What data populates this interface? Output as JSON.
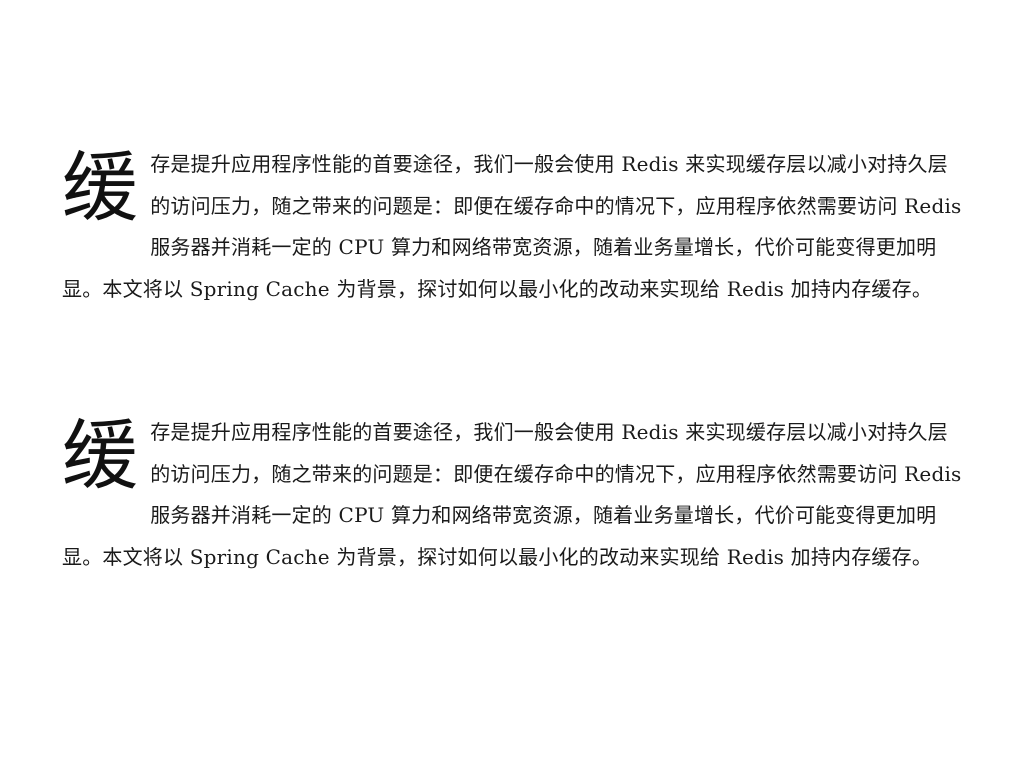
{
  "paragraphs": [
    {
      "dropcap": "缓",
      "text": "存是提升应用程序性能的首要途径，我们一般会使用 Redis 来实现缓存层以减小对持久层的访问压力，随之带来的问题是：即便在缓存命中的情况下，应用程序依然需要访问 Redis 服务器并消耗一定的 CPU 算力和网络带宽资源，随着业务量增长，代价可能变得更加明显。本文将以 Spring Cache 为背景，探讨如何以最小化的改动来实现给 Redis 加持内存缓存。"
    },
    {
      "dropcap": "缓",
      "text": "存是提升应用程序性能的首要途径，我们一般会使用 Redis 来实现缓存层以减小对持久层的访问压力，随之带来的问题是：即便在缓存命中的情况下，应用程序依然需要访问 Redis 服务器并消耗一定的 CPU 算力和网络带宽资源，随着业务量增长，代价可能变得更加明显。本文将以 Spring Cache 为背景，探讨如何以最小化的改动来实现给 Redis 加持内存缓存。"
    }
  ]
}
